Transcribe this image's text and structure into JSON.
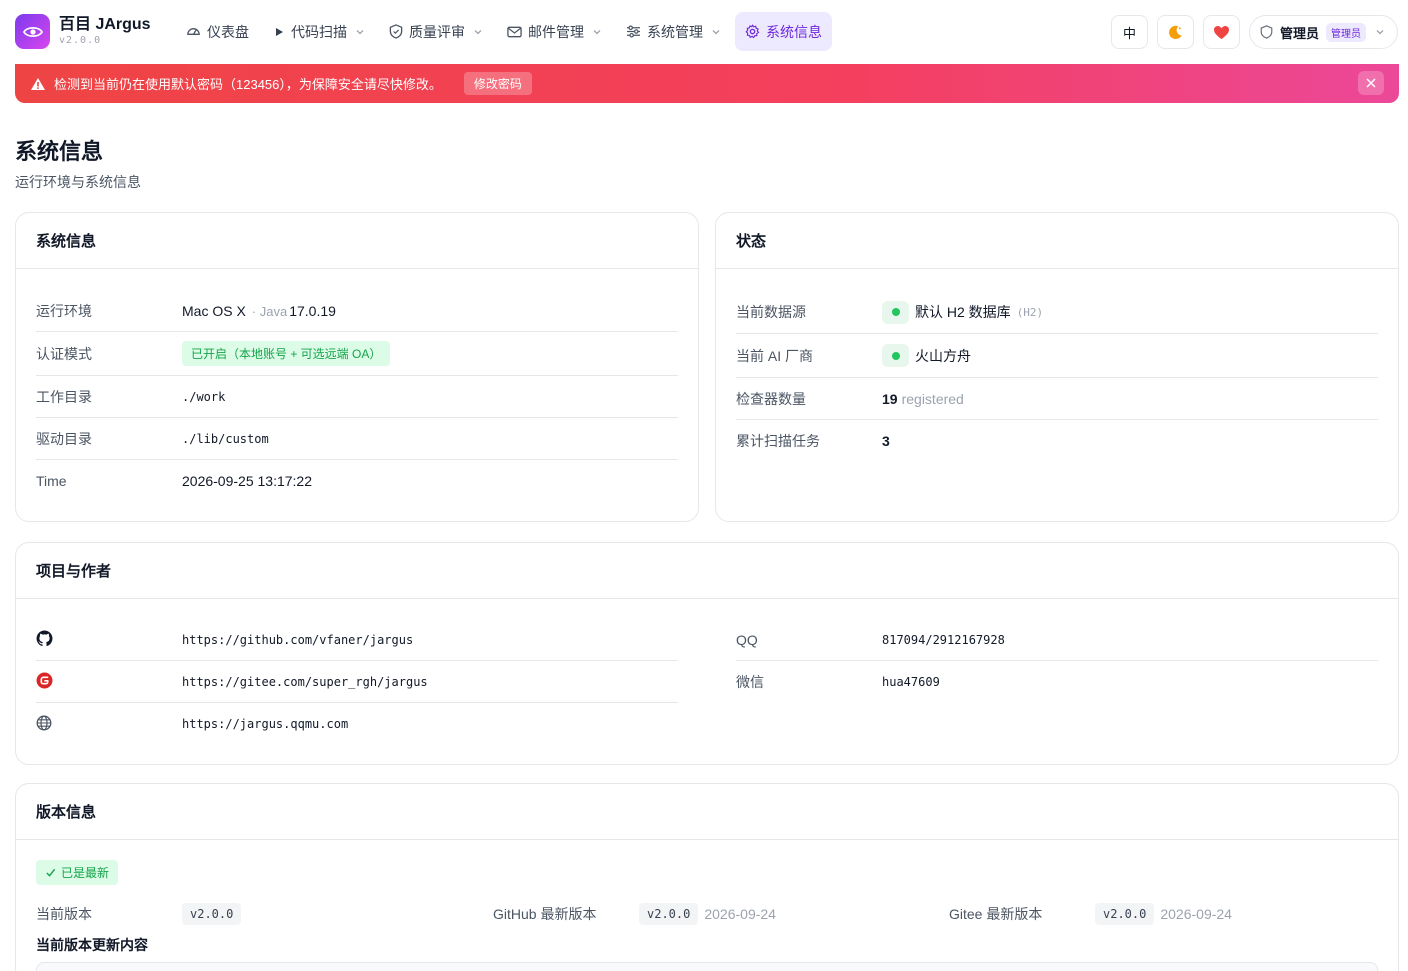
{
  "brand": {
    "name": "百目 JArgus",
    "version": "v2.0.0"
  },
  "nav": [
    {
      "label": "仪表盘",
      "icon": "gauge-icon",
      "dropdown": false,
      "active": false
    },
    {
      "label": "代码扫描",
      "icon": "play-icon",
      "dropdown": true,
      "active": false
    },
    {
      "label": "质量评审",
      "icon": "shield-icon",
      "dropdown": true,
      "active": false
    },
    {
      "label": "邮件管理",
      "icon": "mail-icon",
      "dropdown": true,
      "active": false
    },
    {
      "label": "系统管理",
      "icon": "sliders-icon",
      "dropdown": true,
      "active": false
    },
    {
      "label": "系统信息",
      "icon": "gear-icon",
      "dropdown": false,
      "active": true
    }
  ],
  "tools": {
    "lang": "中",
    "user": "管理员",
    "role": "管理员"
  },
  "alert": {
    "text": "检测到当前仍在使用默认密码（123456），为保障安全请尽快修改。",
    "action": "修改密码"
  },
  "page": {
    "title": "系统信息",
    "subtitle": "运行环境与系统信息"
  },
  "sysinfo": {
    "title": "系统信息",
    "env_label": "运行环境",
    "env_os": "Mac OS X",
    "env_sep": "· Java",
    "env_java": "17.0.19",
    "auth_label": "认证模式",
    "auth_value": "已开启（本地账号 + 可选远端 OA）",
    "workdir_label": "工作目录",
    "workdir_value": "./work",
    "driverdir_label": "驱动目录",
    "driverdir_value": "./lib/custom",
    "time_label": "Time",
    "time_value": "2026-09-25 13:17:22"
  },
  "status": {
    "title": "状态",
    "ds_label": "当前数据源",
    "ds_value": "默认 H2 数据库",
    "ds_tag": "(H2)",
    "ai_label": "当前 AI 厂商",
    "ai_value": "火山方舟",
    "checker_label": "检查器数量",
    "checker_count": "19",
    "checker_suffix": "registered",
    "tasks_label": "累计扫描任务",
    "tasks_value": "3"
  },
  "project": {
    "title": "项目与作者",
    "github_url": "https://github.com/vfaner/jargus",
    "gitee_url": "https://gitee.com/super_rgh/jargus",
    "site_url": "https://jargus.qqmu.com",
    "qq_label": "QQ",
    "qq_value": "817094/2912167928",
    "wechat_label": "微信",
    "wechat_value": "hua47609"
  },
  "version": {
    "title": "版本信息",
    "badge": "已是最新",
    "current_label": "当前版本",
    "current_value": "v2.0.0",
    "github_label": "GitHub 最新版本",
    "github_value": "v2.0.0",
    "github_date": "2026-09-24",
    "gitee_label": "Gitee 最新版本",
    "gitee_value": "v2.0.0",
    "gitee_date": "2026-09-24",
    "changelog_label": "当前版本更新内容"
  },
  "colors": {
    "accent": "#6d28d9",
    "alert_start": "#ef4444",
    "alert_end": "#ec4899",
    "success": "#16a34a"
  }
}
